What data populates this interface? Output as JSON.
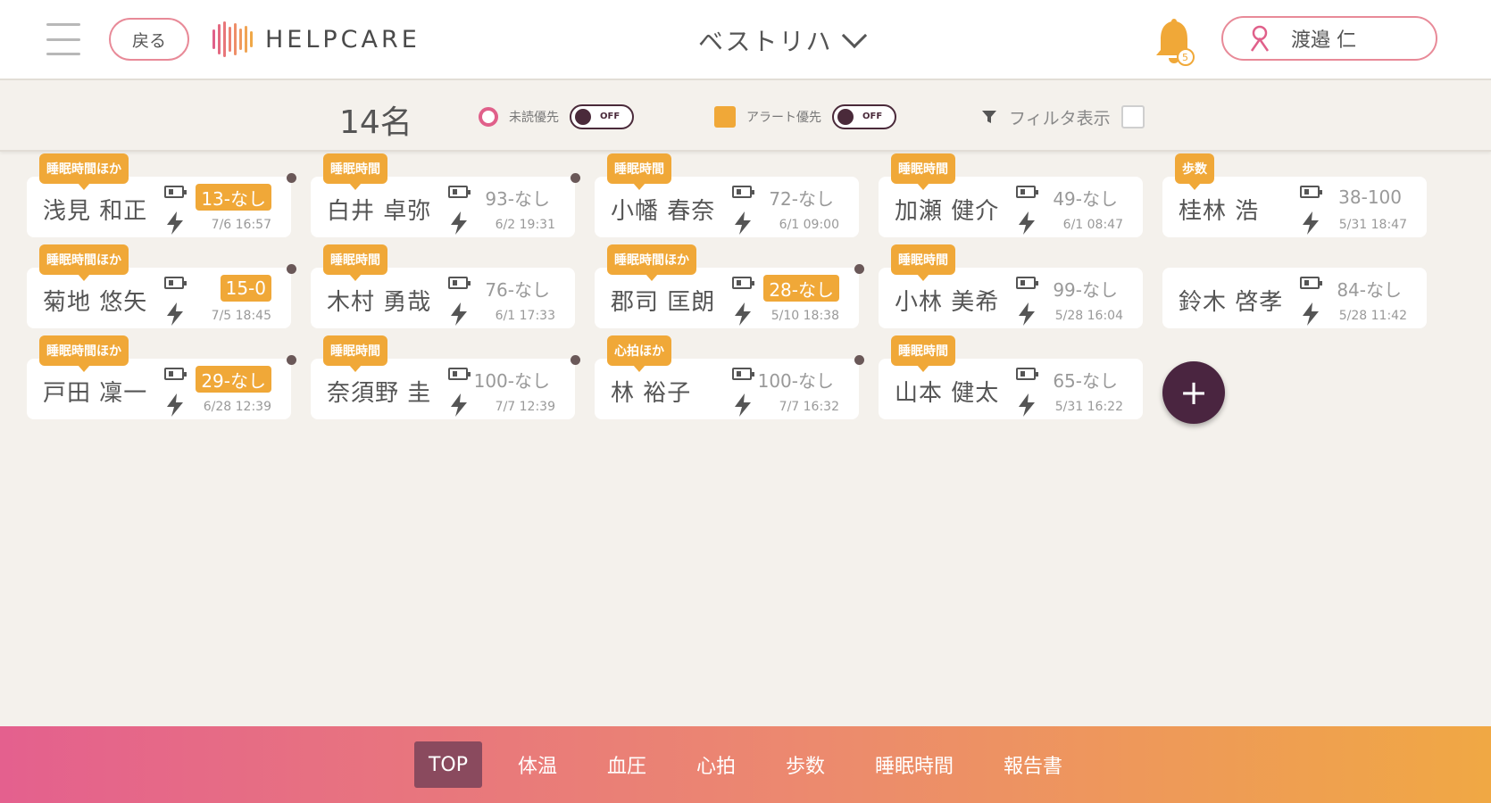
{
  "header": {
    "back_label": "戻る",
    "logo_text": "HELPCARE",
    "facility": "ベストリハ",
    "notification_count": "5",
    "user_name": "渡邉 仁"
  },
  "toolbar": {
    "count": "14名",
    "unread_label": "未読優先",
    "unread_toggle": "OFF",
    "alert_label": "アラート優先",
    "alert_toggle": "OFF",
    "filter_label": "フィルタ表示"
  },
  "colors": {
    "accent_orange": "#f0a838",
    "accent_pink": "#e0608a",
    "dark_plum": "#4a2540"
  },
  "residents": [
    {
      "tag": "睡眠時間ほか",
      "name": "浅見 和正",
      "value": "13-なし",
      "time": "7/6 16:57",
      "alert": true,
      "dot": true
    },
    {
      "tag": "睡眠時間",
      "name": "白井 卓弥",
      "value": "93-なし",
      "time": "6/2 19:31",
      "alert": false,
      "dot": true
    },
    {
      "tag": "睡眠時間",
      "name": "小幡 春奈",
      "value": "72-なし",
      "time": "6/1 09:00",
      "alert": false,
      "dot": false
    },
    {
      "tag": "睡眠時間",
      "name": "加瀬 健介",
      "value": "49-なし",
      "time": "6/1 08:47",
      "alert": false,
      "dot": false
    },
    {
      "tag": "歩数",
      "name": "桂林 浩",
      "value": "38-100",
      "time": "5/31 18:47",
      "alert": false,
      "dot": false
    },
    {
      "tag": "睡眠時間ほか",
      "name": "菊地 悠矢",
      "value": "15-0",
      "time": "7/5 18:45",
      "alert": true,
      "dot": true
    },
    {
      "tag": "睡眠時間",
      "name": "木村 勇哉",
      "value": "76-なし",
      "time": "6/1 17:33",
      "alert": false,
      "dot": false
    },
    {
      "tag": "睡眠時間ほか",
      "name": "郡司 匡朗",
      "value": "28-なし",
      "time": "5/10 18:38",
      "alert": true,
      "dot": true
    },
    {
      "tag": "睡眠時間",
      "name": "小林 美希",
      "value": "99-なし",
      "time": "5/28 16:04",
      "alert": false,
      "dot": false
    },
    {
      "tag": "",
      "name": "鈴木 啓孝",
      "value": "84-なし",
      "time": "5/28 11:42",
      "alert": false,
      "dot": false
    },
    {
      "tag": "睡眠時間ほか",
      "name": "戸田 凜一",
      "value": "29-なし",
      "time": "6/28 12:39",
      "alert": true,
      "dot": true
    },
    {
      "tag": "睡眠時間",
      "name": "奈須野 圭",
      "value": "100-なし",
      "time": "7/7 12:39",
      "alert": false,
      "dot": true
    },
    {
      "tag": "心拍ほか",
      "name": "林 裕子",
      "value": "100-なし",
      "time": "7/7 16:32",
      "alert": false,
      "dot": true
    },
    {
      "tag": "睡眠時間",
      "name": "山本 健太",
      "value": "65-なし",
      "time": "5/31 16:22",
      "alert": false,
      "dot": false
    }
  ],
  "add_label": "+",
  "nav": [
    {
      "label": "TOP",
      "active": true
    },
    {
      "label": "体温",
      "active": false
    },
    {
      "label": "血圧",
      "active": false
    },
    {
      "label": "心拍",
      "active": false
    },
    {
      "label": "歩数",
      "active": false
    },
    {
      "label": "睡眠時間",
      "active": false
    },
    {
      "label": "報告書",
      "active": false
    }
  ]
}
